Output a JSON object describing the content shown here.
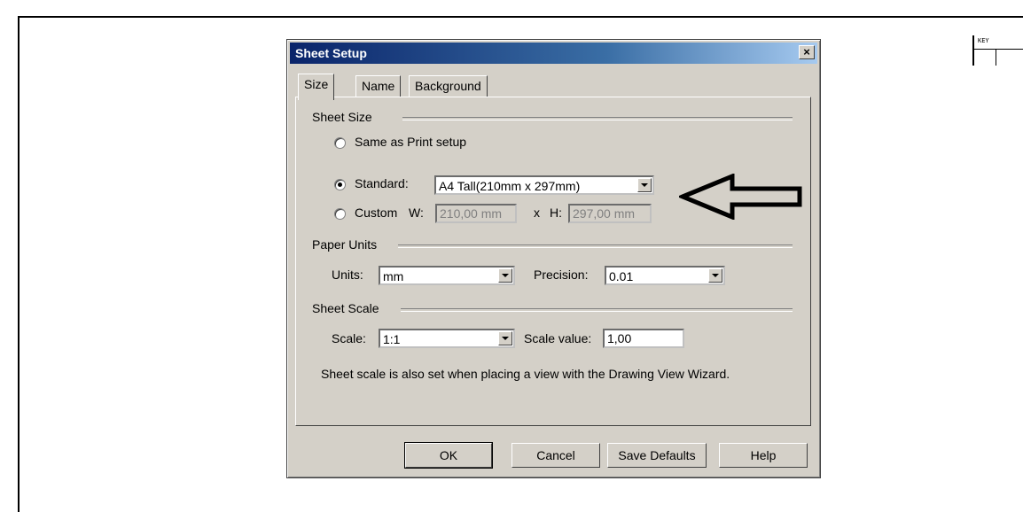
{
  "sheet": {
    "titleblock_text": "KEY"
  },
  "dialog": {
    "title": "Sheet Setup",
    "close_glyph": "×",
    "tabs": [
      {
        "label": "Size"
      },
      {
        "label": "Name"
      },
      {
        "label": "Background"
      }
    ],
    "sheet_size": {
      "label": "Sheet Size",
      "same_as_print": "Same as Print setup",
      "standard": "Standard:",
      "standard_value": "A4 Tall(210mm x 297mm)",
      "custom": "Custom",
      "w_label": "W:",
      "w_value": "210,00 mm",
      "x_label": "x",
      "h_label": "H:",
      "h_value": "297,00 mm",
      "selected": "standard"
    },
    "paper_units": {
      "label": "Paper Units",
      "units_label": "Units:",
      "units_value": "mm",
      "precision_label": "Precision:",
      "precision_value": "0.01"
    },
    "sheet_scale": {
      "label": "Sheet Scale",
      "scale_label": "Scale:",
      "scale_value": "1:1",
      "scale_value_label": "Scale value:",
      "scale_value_value": "1,00",
      "note": "Sheet scale is also set when placing a view with the Drawing View Wizard."
    },
    "buttons": {
      "ok": "OK",
      "cancel": "Cancel",
      "save_defaults": "Save Defaults",
      "help": "Help"
    }
  }
}
